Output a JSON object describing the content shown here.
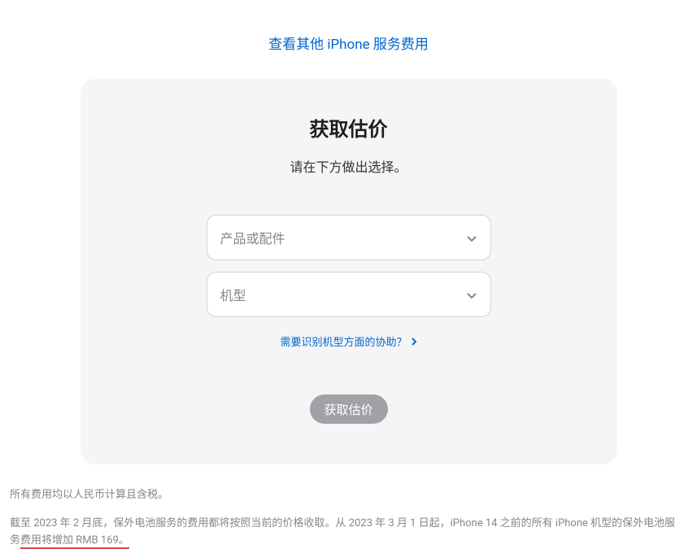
{
  "header": {
    "top_link": "查看其他 iPhone 服务费用"
  },
  "card": {
    "title": "获取估价",
    "subtitle": "请在下方做出选择。",
    "select_product_placeholder": "产品或配件",
    "select_model_placeholder": "机型",
    "help_link": "需要识别机型方面的协助？",
    "button_label": "获取估价"
  },
  "footer": {
    "line1": "所有费用均以人民币计算且含税。",
    "line2_part1": "截至 2023 年 2 月底，保外电池服务的费用都将按照当前的价格收取。从 2023 年 3 月 1 日起，iPhone 14 之前的所有 iPhone 机型的保外电池服务",
    "line2_highlight": "费用将增加 RMB 169。"
  }
}
